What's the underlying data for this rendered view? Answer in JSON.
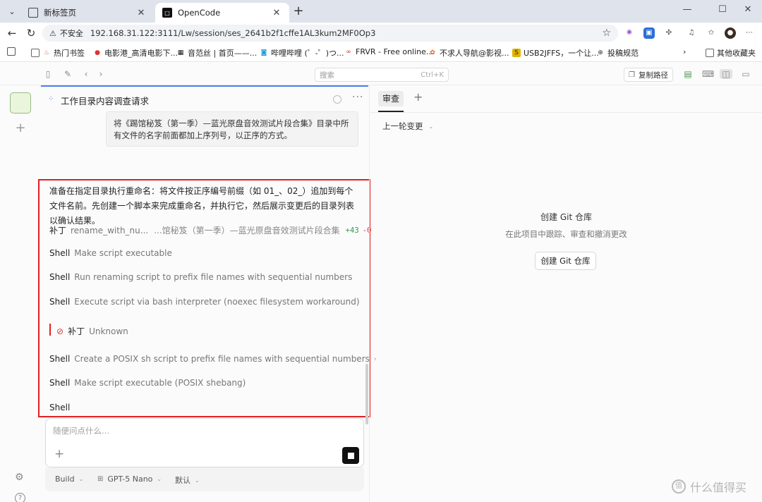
{
  "browser": {
    "tabs": [
      {
        "title": "新标签页",
        "active": false
      },
      {
        "title": "OpenCode",
        "active": true
      }
    ],
    "address": {
      "security_label": "不安全",
      "url": "192.168.31.122:3111/Lw/session/ses_2641b2f1cffe1AL3kum2MF0Op3"
    },
    "bookmarks": [
      "热门书签",
      "电影港_高清电影下...",
      "音范丝 | 首页——...",
      "哔哩哔哩 (゜-゜)つ...",
      "FRVR - Free online...",
      "不求人导航@影视...",
      "USB2JFFS，一个让...",
      "投稿规范"
    ],
    "other_bookmarks": "其他收藏夹"
  },
  "toolbar": {
    "search_placeholder": "搜索",
    "search_shortcut": "Ctrl+K",
    "copy_path_label": "复制路径"
  },
  "session": {
    "title": "工作目录内容调查请求",
    "user_message": "将《踢馆秘笈（第一季）—蓝光原盘音效测试片段合集》目录中所有文件的名字前面都加上序列号，以正序的方式。",
    "assistant_text": "准备在指定目录执行重命名：将文件按正序编号前缀（如 01_、02_）追加到每个文件名前。先创建一个脚本来完成重命名，并执行它，然后展示变更后的目录列表以确认结果。",
    "steps": [
      {
        "kind": "补丁",
        "desc": "rename_with_nu...",
        "path": "...馆秘笈（第一季）—蓝光原盘音效测试片段合集",
        "added": "+43",
        "removed": "-0"
      },
      {
        "kind": "Shell",
        "desc": "Make script executable"
      },
      {
        "kind": "Shell",
        "desc": "Run renaming script to prefix file names with sequential numbers"
      },
      {
        "kind": "Shell",
        "desc": "Execute script via bash interpreter (noexec filesystem workaround)"
      },
      {
        "kind": "补丁",
        "desc": "Unknown",
        "error": true
      },
      {
        "kind": "Shell",
        "desc": "Create a POSIX sh script to prefix file names with sequential numbers",
        "chevron": "›"
      },
      {
        "kind": "Shell",
        "desc": "Make script executable (POSIX shebang)"
      },
      {
        "kind": "Shell",
        "desc": ""
      }
    ]
  },
  "composer": {
    "placeholder": "随便问点什么...",
    "agent": "Build",
    "model": "GPT-5 Nano",
    "variant": "默认"
  },
  "review": {
    "tab_label": "审查",
    "changes_selector": "上一轮变更",
    "empty_title": "创建 Git 仓库",
    "empty_subtitle": "在此项目中跟踪、审查和撤消更改",
    "create_button": "创建 Git 仓库"
  },
  "watermark": "什么值得买",
  "colors": {
    "accent": "#4a7ef0",
    "highlight_box": "#e02020",
    "added": "#2c9a4a",
    "removed": "#d33a3a"
  }
}
